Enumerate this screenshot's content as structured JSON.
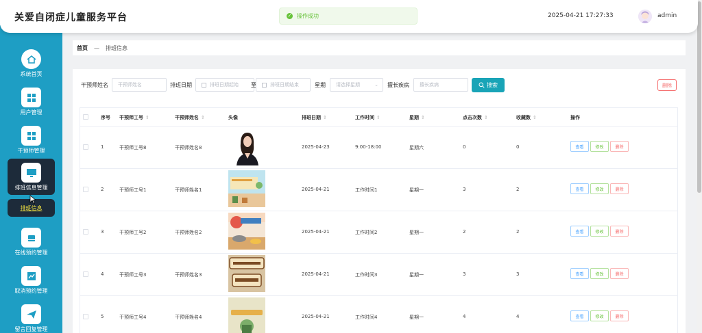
{
  "header": {
    "app_title": "关爱自闭症儿童服务平台",
    "toast": "操作成功",
    "datetime": "2025-04-21 17:27:33",
    "username": "admin"
  },
  "sidebar": {
    "items": [
      {
        "label": "系统首页",
        "icon": "home-icon"
      },
      {
        "label": "用户管理",
        "icon": "grid-icon"
      },
      {
        "label": "干预师管理",
        "icon": "grid-icon"
      },
      {
        "label": "排班信息管理",
        "icon": "monitor-icon",
        "active": true
      },
      {
        "label": "在线预约管理",
        "icon": "calendar-icon"
      },
      {
        "label": "取消预约管理",
        "icon": "trend-icon"
      },
      {
        "label": "留言回复管理",
        "icon": "send-icon"
      }
    ],
    "sub_item": "排班信息"
  },
  "breadcrumb": {
    "home": "首页",
    "separator": "—",
    "current": "排班信息"
  },
  "filters": {
    "labels": {
      "name": "干预师姓名",
      "date": "排班日期",
      "to": "至",
      "week": "星期",
      "specialty": "擅长疾病"
    },
    "placeholders": {
      "name": "干预师姓名",
      "date_start": "排班日期起始",
      "date_end": "排班日期结束",
      "week": "请选择星期",
      "specialty": "擅长疾病"
    },
    "search_button": "搜索",
    "delete_button": "删除"
  },
  "table": {
    "headers": [
      "序号",
      "干预师工号",
      "干预师姓名",
      "头像",
      "排班日期",
      "工作时间",
      "星期",
      "点击次数",
      "收藏数",
      "操作"
    ],
    "actions": {
      "view": "查看",
      "edit": "修改",
      "delete": "删除"
    },
    "rows": [
      {
        "index": "1",
        "id": "干预师工号8",
        "name": "干预师姓名8",
        "date": "2025-04-23",
        "time": "9:00-18:00",
        "week": "星期六",
        "clicks": "0",
        "favs": "0"
      },
      {
        "index": "2",
        "id": "干预师工号1",
        "name": "干预师姓名1",
        "date": "2025-04-21",
        "time": "工作时间1",
        "week": "星期一",
        "clicks": "3",
        "favs": "2"
      },
      {
        "index": "3",
        "id": "干预师工号2",
        "name": "干预师姓名2",
        "date": "2025-04-21",
        "time": "工作时间2",
        "week": "星期一",
        "clicks": "2",
        "favs": "2"
      },
      {
        "index": "4",
        "id": "干预师工号3",
        "name": "干预师姓名3",
        "date": "2025-04-21",
        "time": "工作时间3",
        "week": "星期一",
        "clicks": "3",
        "favs": "3"
      },
      {
        "index": "5",
        "id": "干预师工号4",
        "name": "干预师姓名4",
        "date": "2025-04-21",
        "time": "工作时间4",
        "week": "星期一",
        "clicks": "4",
        "favs": "4"
      }
    ]
  },
  "colors": {
    "sidebar": "#1e9ec4",
    "active": "#1d2b3a",
    "primary": "#19a4b7",
    "danger": "#f56c6c",
    "success": "#67c23a"
  }
}
